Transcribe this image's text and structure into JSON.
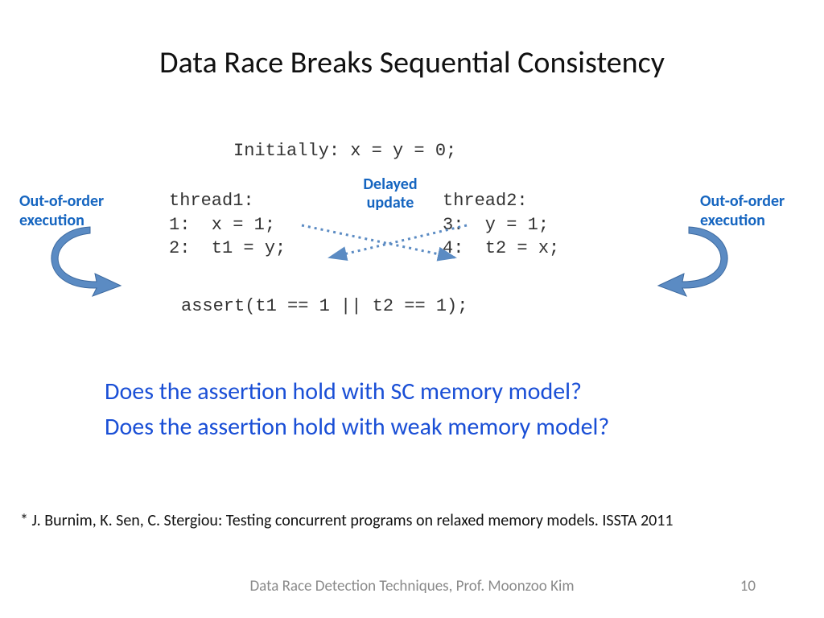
{
  "title": "Data Race Breaks Sequential Consistency",
  "code": {
    "initial": "Initially: x = y = 0;",
    "thread1_header": "thread1:",
    "thread1_line1": "1:  x = 1;",
    "thread1_line2": "2:  t1 = y;",
    "thread2_header": "thread2:",
    "thread2_line1": "3:  y = 1;",
    "thread2_line2": "4:  t2 = x;",
    "assert": "assert(t1 == 1 || t2 == 1);"
  },
  "labels": {
    "ooo_left": "Out-of-order execution",
    "ooo_right": "Out-of-order execution",
    "delayed": "Delayed update"
  },
  "questions": {
    "q1": "Does the assertion hold with SC memory model?",
    "q2": "Does the assertion hold with weak memory model?"
  },
  "citation": "* J. Burnim, K. Sen, C. Stergiou: Testing concurrent programs on relaxed memory models. ISSTA 2011",
  "footer": {
    "label": "Data Race Detection Techniques, Prof. Moonzoo Kim",
    "page": "10"
  },
  "colors": {
    "accent_blue": "#1565c0",
    "link_blue": "#1a4fd6",
    "arrow_fill": "#5b8bc3",
    "arrow_stroke": "#3d6aa0",
    "dotted": "#5b8bc3"
  }
}
